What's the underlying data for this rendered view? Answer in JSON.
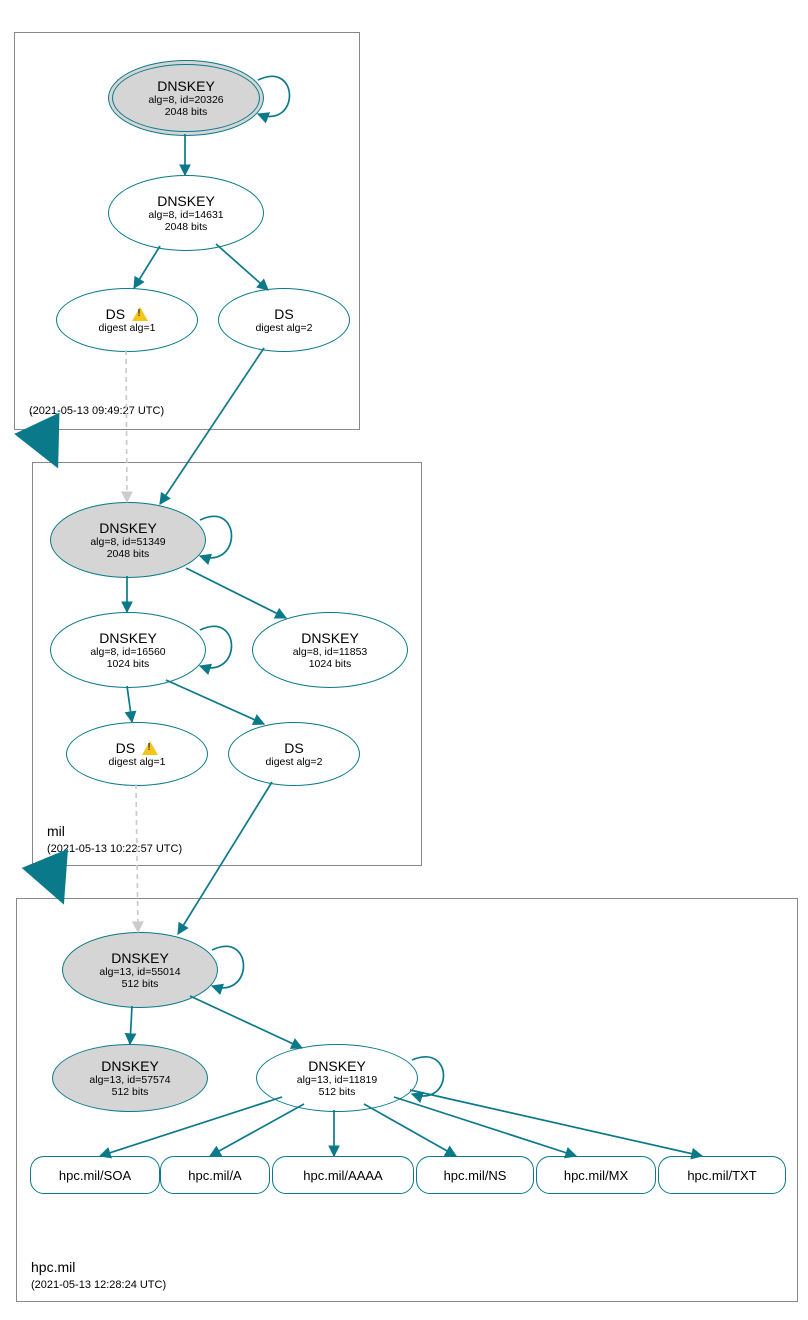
{
  "colors": {
    "stroke": "#0a7a8a",
    "greyFill": "#d5d5d5",
    "dashed": "#cccccc",
    "warn": "#f5c518"
  },
  "zones": {
    "root": {
      "name": ".",
      "time": "(2021-05-13 09:49:27 UTC)"
    },
    "mil": {
      "name": "mil",
      "time": "(2021-05-13 10:22:57 UTC)"
    },
    "hpc": {
      "name": "hpc.mil",
      "time": "(2021-05-13 12:28:24 UTC)"
    }
  },
  "nodes": {
    "root_ksk": {
      "title": "DNSKEY",
      "l1": "alg=8, id=20326",
      "l2": "2048 bits"
    },
    "root_zsk": {
      "title": "DNSKEY",
      "l1": "alg=8, id=14631",
      "l2": "2048 bits"
    },
    "root_ds1": {
      "title": "DS",
      "l1": "digest alg=1",
      "warn": true
    },
    "root_ds2": {
      "title": "DS",
      "l1": "digest alg=2"
    },
    "mil_ksk": {
      "title": "DNSKEY",
      "l1": "alg=8, id=51349",
      "l2": "2048 bits"
    },
    "mil_zsk1": {
      "title": "DNSKEY",
      "l1": "alg=8, id=16560",
      "l2": "1024 bits"
    },
    "mil_zsk2": {
      "title": "DNSKEY",
      "l1": "alg=8, id=11853",
      "l2": "1024 bits"
    },
    "mil_ds1": {
      "title": "DS",
      "l1": "digest alg=1",
      "warn": true
    },
    "mil_ds2": {
      "title": "DS",
      "l1": "digest alg=2"
    },
    "hpc_ksk": {
      "title": "DNSKEY",
      "l1": "alg=13, id=55014",
      "l2": "512 bits"
    },
    "hpc_k2": {
      "title": "DNSKEY",
      "l1": "alg=13, id=57574",
      "l2": "512 bits"
    },
    "hpc_zsk": {
      "title": "DNSKEY",
      "l1": "alg=13, id=11819",
      "l2": "512 bits"
    }
  },
  "rrsets": {
    "soa": "hpc.mil/SOA",
    "a": "hpc.mil/A",
    "aaaa": "hpc.mil/AAAA",
    "ns": "hpc.mil/NS",
    "mx": "hpc.mil/MX",
    "txt": "hpc.mil/TXT"
  }
}
